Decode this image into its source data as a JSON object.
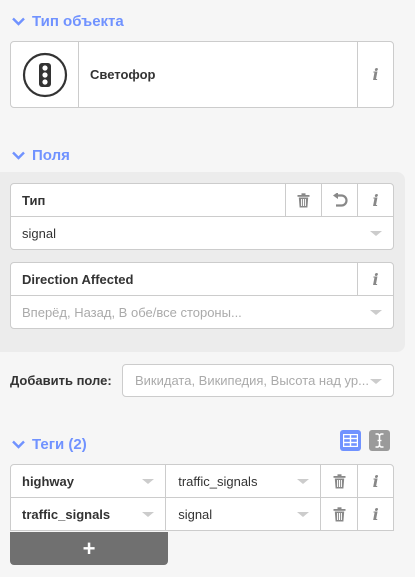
{
  "preset_section": {
    "title": "Тип объекта",
    "preset_name": "Светофор",
    "icon": "traffic-light-icon"
  },
  "fields_section": {
    "title": "Поля",
    "fields": [
      {
        "label": "Тип",
        "value": "signal"
      },
      {
        "label": "Direction Affected",
        "placeholder": "Вперёд, Назад, В обе/все стороны..."
      }
    ]
  },
  "add_field": {
    "label": "Добавить поле:",
    "placeholder": "Викидата, Википедия, Высота над ур..."
  },
  "tags_section": {
    "title": "Теги (2)",
    "tags": [
      {
        "key": "highway",
        "value": "traffic_signals"
      },
      {
        "key": "traffic_signals",
        "value": "signal"
      }
    ],
    "add_label": "+"
  },
  "colors": {
    "accent": "#7092ff",
    "border": "#cccccc",
    "muted": "#888888",
    "panel_bg": "#ececec"
  }
}
